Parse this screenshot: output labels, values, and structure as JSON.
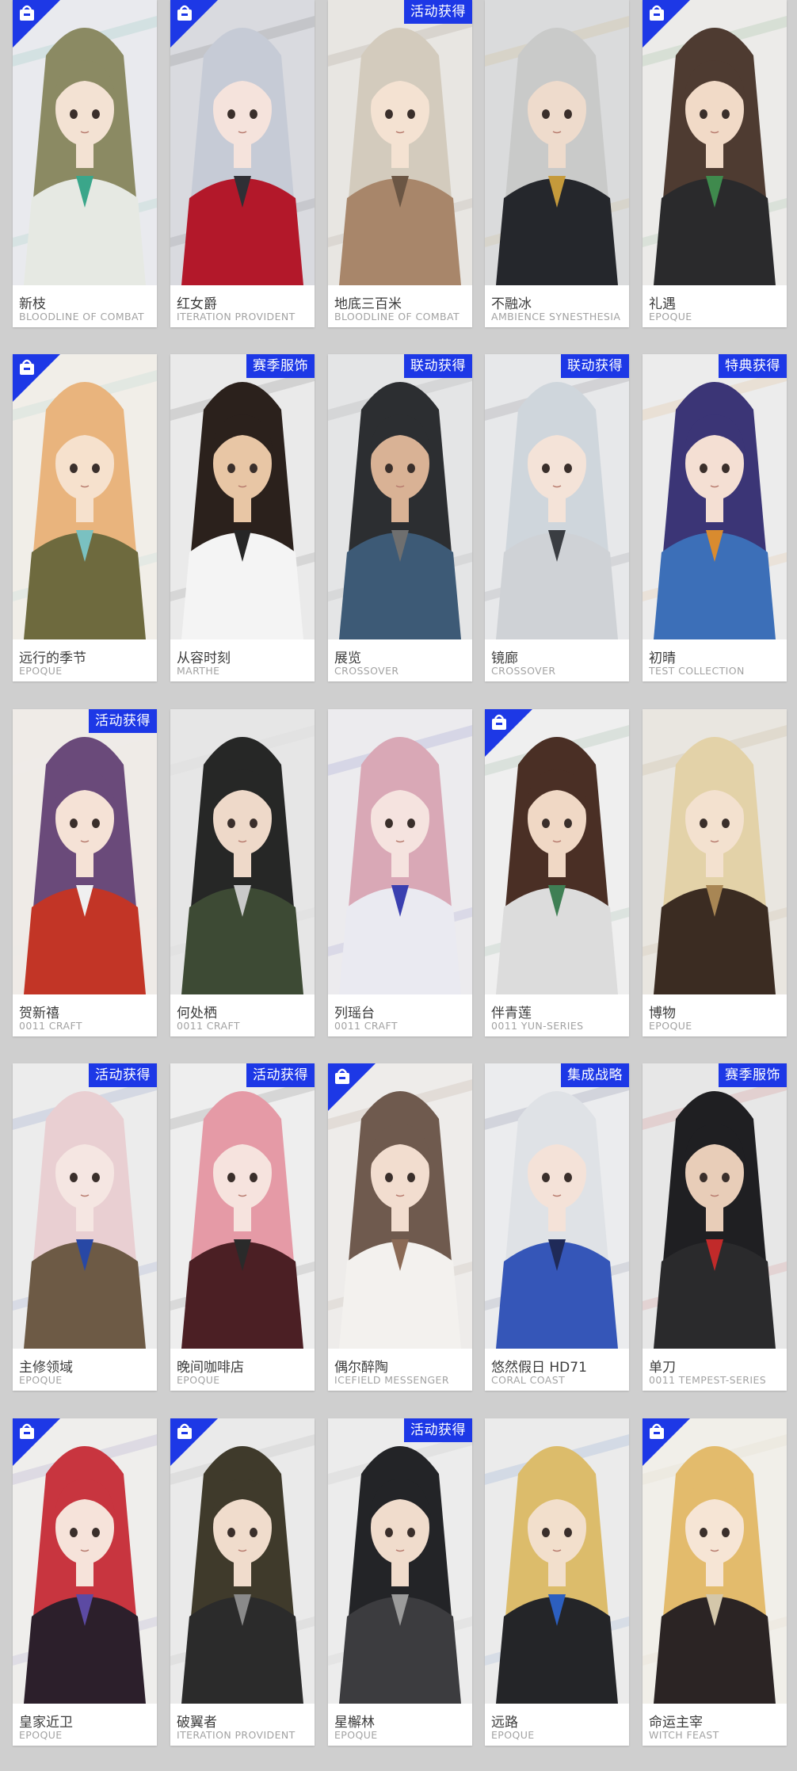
{
  "colors": {
    "badge": "#1d38e6",
    "page_background": "#cfcfcf",
    "card": "#ffffff"
  },
  "icons": {
    "corner": "shop-bag-icon"
  },
  "cards": [
    {
      "name": "新枝",
      "series": "BLOODLINE OF COMBAT",
      "badge": "",
      "corner": true,
      "palette": {
        "bg": "#e9eaee",
        "hair": "#8b8a63",
        "skin": "#f3e2d3",
        "outfit": "#e6e9e3",
        "accent": "#3aa68a"
      }
    },
    {
      "name": "红女爵",
      "series": "ITERATION PROVIDENT",
      "badge": "",
      "corner": true,
      "palette": {
        "bg": "#d9dadf",
        "hair": "#c6cbd6",
        "skin": "#f5e3dc",
        "outfit": "#b3182a",
        "accent": "#2f2f35"
      }
    },
    {
      "name": "地底三百米",
      "series": "BLOODLINE OF COMBAT",
      "badge": "活动获得",
      "corner": false,
      "palette": {
        "bg": "#e8e6e2",
        "hair": "#d3cbbd",
        "skin": "#f4e2d2",
        "outfit": "#a8866a",
        "accent": "#6b5644"
      }
    },
    {
      "name": "不融冰",
      "series": "AMBIENCE SYNESTHESIA",
      "badge": "",
      "corner": false,
      "palette": {
        "bg": "#dadbdc",
        "hair": "#c9cac9",
        "skin": "#eedbcc",
        "outfit": "#25272c",
        "accent": "#c59a3b"
      }
    },
    {
      "name": "礼遇",
      "series": "EPOQUE",
      "badge": "",
      "corner": true,
      "palette": {
        "bg": "#ecebe9",
        "hair": "#4e3b31",
        "skin": "#f1dac7",
        "outfit": "#2a2a2c",
        "accent": "#3f8a4d"
      }
    },
    {
      "name": "远行的季节",
      "series": "EPOQUE",
      "badge": "",
      "corner": true,
      "palette": {
        "bg": "#f1eee8",
        "hair": "#e9b47d",
        "skin": "#f6e1cd",
        "outfit": "#6e6a3e",
        "accent": "#7ac1c1"
      }
    },
    {
      "name": "从容时刻",
      "series": "MARTHE",
      "badge": "赛季服饰",
      "corner": false,
      "palette": {
        "bg": "#eaeaea",
        "hair": "#2b211c",
        "skin": "#e8c6a5",
        "outfit": "#f4f4f4",
        "accent": "#262626"
      }
    },
    {
      "name": "展览",
      "series": "CROSSOVER",
      "badge": "联动获得",
      "corner": false,
      "palette": {
        "bg": "#e4e5e6",
        "hair": "#2c2e31",
        "skin": "#d9b295",
        "outfit": "#3d5a76",
        "accent": "#6f6f6f"
      }
    },
    {
      "name": "镜廊",
      "series": "CROSSOVER",
      "badge": "联动获得",
      "corner": false,
      "palette": {
        "bg": "#e7e8ea",
        "hair": "#cfd6dc",
        "skin": "#f4e3d8",
        "outfit": "#cfd2d6",
        "accent": "#3a3d42"
      }
    },
    {
      "name": "初晴",
      "series": "TEST COLLECTION",
      "badge": "特典获得",
      "corner": false,
      "palette": {
        "bg": "#ececec",
        "hair": "#3b3576",
        "skin": "#f4dfd3",
        "outfit": "#3c6fb8",
        "accent": "#d98b2f"
      }
    },
    {
      "name": "贺新禧",
      "series": "0011 CRAFT",
      "badge": "活动获得",
      "corner": false,
      "palette": {
        "bg": "#efebe7",
        "hair": "#6a4a7a",
        "skin": "#f5e2d6",
        "outfit": "#c23526",
        "accent": "#f0f0f0"
      }
    },
    {
      "name": "何处栖",
      "series": "0011 CRAFT",
      "badge": "",
      "corner": false,
      "palette": {
        "bg": "#e6e6e6",
        "hair": "#262726",
        "skin": "#eed9c9",
        "outfit": "#3d4a34",
        "accent": "#c9c9c9"
      }
    },
    {
      "name": "列瑶台",
      "series": "0011 CRAFT",
      "badge": "",
      "corner": false,
      "palette": {
        "bg": "#ecebee",
        "hair": "#d9a8b6",
        "skin": "#f5e3df",
        "outfit": "#eaeaf1",
        "accent": "#3a3fb0"
      }
    },
    {
      "name": "伴青莲",
      "series": "0011 YUN-SERIES",
      "badge": "",
      "corner": true,
      "palette": {
        "bg": "#efefef",
        "hair": "#4a2f25",
        "skin": "#f0d8c5",
        "outfit": "#dcdcdc",
        "accent": "#3f7f54"
      }
    },
    {
      "name": "博物",
      "series": "EPOQUE",
      "badge": "",
      "corner": false,
      "palette": {
        "bg": "#e9e6e0",
        "hair": "#e3d2a8",
        "skin": "#f3e1cf",
        "outfit": "#3b2c22",
        "accent": "#a88654"
      }
    },
    {
      "name": "主修领域",
      "series": "EPOQUE",
      "badge": "活动获得",
      "corner": false,
      "palette": {
        "bg": "#ececec",
        "hair": "#e9cfd2",
        "skin": "#f5e6e2",
        "outfit": "#6d5a45",
        "accent": "#2848a5"
      }
    },
    {
      "name": "晚间咖啡店",
      "series": "EPOQUE",
      "badge": "活动获得",
      "corner": false,
      "palette": {
        "bg": "#eeeeee",
        "hair": "#e59aa6",
        "skin": "#f6e3de",
        "outfit": "#4b1f24",
        "accent": "#2a2a2a"
      }
    },
    {
      "name": "偶尔醉陶",
      "series": "ICEFIELD MESSENGER",
      "badge": "",
      "corner": true,
      "palette": {
        "bg": "#eeecea",
        "hair": "#6f5a4e",
        "skin": "#f2ddcf",
        "outfit": "#f3f1ee",
        "accent": "#8b6a55"
      }
    },
    {
      "name": "悠然假日 HD71",
      "series": "CORAL COAST",
      "badge": "集成战略",
      "corner": false,
      "palette": {
        "bg": "#ebecee",
        "hair": "#dfe2e6",
        "skin": "#f4e2d8",
        "outfit": "#3556b8",
        "accent": "#1f2a58"
      }
    },
    {
      "name": "单刀",
      "series": "0011 TEMPEST-SERIES",
      "badge": "赛季服饰",
      "corner": false,
      "palette": {
        "bg": "#e7e7e7",
        "hair": "#1f1f22",
        "skin": "#e8cdb8",
        "outfit": "#2a2a2c",
        "accent": "#c12a2a"
      }
    },
    {
      "name": "皇家近卫",
      "series": "EPOQUE",
      "badge": "",
      "corner": true,
      "palette": {
        "bg": "#efeeec",
        "hair": "#c8353f",
        "skin": "#f6e3da",
        "outfit": "#2c1f2b",
        "accent": "#5c4aa3"
      }
    },
    {
      "name": "破翼者",
      "series": "ITERATION PROVIDENT",
      "badge": "",
      "corner": true,
      "palette": {
        "bg": "#eaeaea",
        "hair": "#3f3a2b",
        "skin": "#f0dccc",
        "outfit": "#2b2b2b",
        "accent": "#8a8a8a"
      }
    },
    {
      "name": "星檞林",
      "series": "EPOQUE",
      "badge": "活动获得",
      "corner": false,
      "palette": {
        "bg": "#ececec",
        "hair": "#232427",
        "skin": "#f0dccc",
        "outfit": "#3c3c3f",
        "accent": "#9b9b9b"
      }
    },
    {
      "name": "远路",
      "series": "EPOQUE",
      "badge": "",
      "corner": false,
      "palette": {
        "bg": "#ebebeb",
        "hair": "#dcbc6b",
        "skin": "#f2dfcc",
        "outfit": "#242528",
        "accent": "#2c5fbf"
      }
    },
    {
      "name": "命运主宰",
      "series": "WITCH FEAST",
      "badge": "",
      "corner": true,
      "palette": {
        "bg": "#f1efe9",
        "hair": "#e3bb6c",
        "skin": "#f6e5d5",
        "outfit": "#2b2424",
        "accent": "#d4c7aa"
      }
    }
  ]
}
